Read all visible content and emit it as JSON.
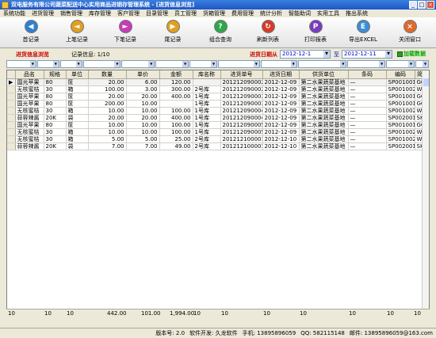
{
  "window": {
    "title": "双电服务有限公司蔬菜配送中心实用商品进销存管理系统 - [进货信息浏览]",
    "buttons": [
      "_",
      "□",
      "×"
    ]
  },
  "menu": [
    "系统功能",
    "进货管理",
    "销售管理",
    "库存管理",
    "客户管理",
    "目录管理",
    "员工管理",
    "货箱管理",
    "费用管理",
    "统计分析",
    "智能助词",
    "实用工具",
    "推出系统"
  ],
  "toolbar": [
    {
      "label": "首记录",
      "icon": "first-record-icon",
      "color": "#2f7fd1",
      "glyph": "◀"
    },
    {
      "label": "上笔记录",
      "icon": "prev-record-icon",
      "color": "#e0a020",
      "glyph": "◄"
    },
    {
      "label": "下笔记录",
      "icon": "next-record-icon",
      "color": "#c63bb8",
      "glyph": "►"
    },
    {
      "label": "尾记录",
      "icon": "last-record-icon",
      "color": "#e0a020",
      "glyph": "▶"
    },
    {
      "label": "组合查询",
      "icon": "query-icon",
      "color": "#2fa64a",
      "glyph": "?"
    },
    {
      "label": "刷新列表",
      "icon": "refresh-icon",
      "color": "#d63a2a",
      "glyph": "↻"
    },
    {
      "label": "打印报表",
      "icon": "print-icon",
      "color": "#7a3bbf",
      "glyph": "P"
    },
    {
      "label": "导出EXCEL",
      "icon": "excel-icon",
      "color": "#3a8fd6",
      "glyph": "E"
    },
    {
      "label": "关闭窗口",
      "icon": "close-window-icon",
      "color": "#e06a2a",
      "glyph": "×"
    }
  ],
  "filter": {
    "browse_title": "进货信息浏览",
    "record_info": "记录信息: 1/10",
    "date_label": "进货日期从",
    "date_from": "2012-12-1",
    "to_label": "至",
    "date_to": "2012-12-11",
    "load_button": "加载数据"
  },
  "table": {
    "columns": [
      "品名",
      "规格",
      "单位",
      "数量",
      "单价",
      "金额",
      "库名称",
      "进货单号",
      "进货日期",
      "供货单位",
      "条码",
      "编码",
      "简码"
    ],
    "rows": [
      [
        "国光苹果",
        "80",
        "筐",
        "20.00",
        "6.00",
        "120.00",
        "",
        "201212090002",
        "2012-12-09",
        "第二水果蔬菜基地",
        "—",
        "SP001001",
        "GGPG"
      ],
      [
        "无核蜜桔",
        "30",
        "箱",
        "100.00",
        "3.00",
        "300.00",
        "2号库",
        "201212090002",
        "2012-12-09",
        "第二水果蔬菜基地",
        "—",
        "SP001002",
        "WHMJ"
      ],
      [
        "国光苹果",
        "80",
        "筐",
        "20.00",
        "20.00",
        "400.00",
        "1号库",
        "201212090003",
        "2012-12-09",
        "第二水果蔬菜基地",
        "—",
        "SP001001",
        "GGPG"
      ],
      [
        "国光苹果",
        "80",
        "筐",
        "200.00",
        "10.00",
        "",
        "1号库",
        "201212090003",
        "2012-12-09",
        "第二水果蔬菜基地",
        "—",
        "SP001001",
        "GGPG"
      ],
      [
        "无核蜜桔",
        "30",
        "箱",
        "10.00",
        "10.00",
        "100.00",
        "1号库",
        "201212090004",
        "2012-12-09",
        "第二水果蔬菜基地",
        "—",
        "SP001002",
        "WHMJ"
      ],
      [
        "蒜蓉辣酱",
        "20K",
        "袋",
        "20.00",
        "20.00",
        "400.00",
        "1号库",
        "201212090004",
        "2012-12-09",
        "第二水果蔬菜基地",
        "—",
        "SP002001",
        "SKLJ"
      ],
      [
        "国光苹果",
        "80",
        "筐",
        "10.00",
        "10.00",
        "100.00",
        "1号库",
        "201212090005",
        "2012-12-09",
        "第二水果蔬菜基地",
        "—",
        "SP001001",
        "GGPG"
      ],
      [
        "无核蜜桔",
        "30",
        "箱",
        "10.00",
        "10.00",
        "100.00",
        "1号库",
        "201212090005",
        "2012-12-09",
        "第二水果蔬菜基地",
        "—",
        "SP001002",
        "WHMJ"
      ],
      [
        "无核蜜桔",
        "30",
        "箱",
        "5.00",
        "5.00",
        "25.00",
        "2号库",
        "201212100001",
        "2012-12-10",
        "第二水果蔬菜基地",
        "—",
        "SP001002",
        "WHMJ"
      ],
      [
        "蒜蓉辣酱",
        "20K",
        "袋",
        "7.00",
        "7.00",
        "49.00",
        "2号库",
        "201212100001",
        "2012-12-10",
        "第二水果蔬菜基地",
        "—",
        "SP002001",
        "SKLJ"
      ]
    ],
    "totals": {
      "c1": "10",
      "c2": "10",
      "c3": "10",
      "qty": "442.00",
      "price": "101.00",
      "amount": "1,994.00",
      "c7": "10",
      "c8": "10",
      "c9": "10",
      "c10": "10",
      "c11": "10",
      "c12": "10",
      "c13": "10"
    }
  },
  "status": {
    "version": "版本号: 2.0",
    "developer": "软件开发: 久龙软件",
    "phone": "手机: 13895896059",
    "qq": "QQ: 582115148",
    "email": "邮件: 13895896059@163.com"
  }
}
